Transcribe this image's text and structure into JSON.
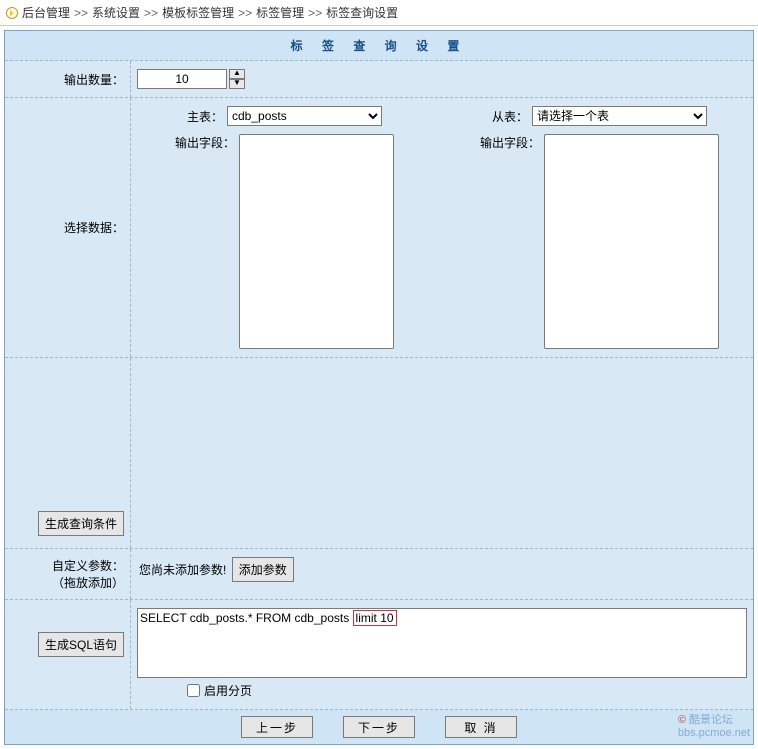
{
  "breadcrumb": {
    "items": [
      "后台管理",
      "系统设置",
      "模板标签管理",
      "标签管理",
      "标签查询设置"
    ],
    "sep": ">>"
  },
  "title": "标 签 查 询 设 置",
  "rows": {
    "output_count": {
      "label": "输出数量：",
      "value": "10"
    },
    "select_data": {
      "label": "选择数据：",
      "main_table_label": "主表：",
      "main_table_value": "cdb_posts",
      "sub_table_label": "从表：",
      "sub_table_value": "请选择一个表",
      "output_field_label": "输出字段："
    },
    "gen_query": {
      "button": "生成查询条件"
    },
    "custom_params": {
      "label1": "自定义参数：",
      "label2": "（拖放添加）",
      "empty_text": "您尚未添加参数!",
      "add_button": "添加参数"
    },
    "gen_sql": {
      "button": "生成SQL语句",
      "sql_prefix": "SELECT cdb_posts.* FROM cdb_posts ",
      "sql_limit": "limit 10"
    },
    "paging": {
      "label": "启用分页"
    }
  },
  "footer": {
    "prev": "上一步",
    "next": "下一步",
    "cancel": "取 消"
  },
  "watermark": {
    "logo": "©",
    "text1": "酷景论坛",
    "text2": "bbs.pcmoe.net"
  }
}
